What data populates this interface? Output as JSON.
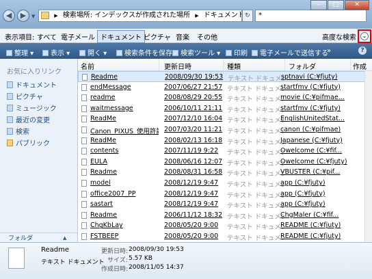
{
  "address": {
    "path_root": "検索場所: インデックスが作成された場所",
    "path_sep": "▶",
    "path_leaf": "ドキュメント",
    "search_value": "*"
  },
  "filter": {
    "label": "表示項目:",
    "items": [
      "すべて",
      "電子メール",
      "ドキュメント",
      "ピクチャ",
      "音楽",
      "その他"
    ],
    "advanced": "高度な検索"
  },
  "toolbar": {
    "items": [
      "整理",
      "表示",
      "開く",
      "検索条件を保存",
      "検索ツール",
      "印刷",
      "電子メールで送信する"
    ],
    "more": "»",
    "help": "?"
  },
  "nav": {
    "title": "お気に入りリンク",
    "items": [
      "ドキュメント",
      "ピクチャ",
      "ミュージック",
      "最近の変更",
      "検索",
      "パブリック"
    ],
    "folder_label": "フォルダ"
  },
  "columns": [
    "名前",
    "更新日時",
    "種類",
    "フォルダ",
    "作成"
  ],
  "rows": [
    {
      "name": "Readme",
      "date": "2008/09/30 19:53",
      "type": "テキスト ドキュメント",
      "folder": "sptnavi (C:¥fjuty)"
    },
    {
      "name": "endMessage",
      "date": "2007/06/27 21:57",
      "type": "テキスト ドキュメント",
      "folder": "startfmv (C:¥fjuty)"
    },
    {
      "name": "readme",
      "date": "2008/08/29 20:55",
      "type": "テキスト ドキュメント",
      "folder": "movie (C:¥pifmae..."
    },
    {
      "name": "waitmessage",
      "date": "2006/10/11 21:11",
      "type": "テキスト ドキュメント",
      "folder": "startfmv (C:¥fjuty)"
    },
    {
      "name": "ReadMe",
      "date": "2007/12/10 16:04",
      "type": "テキスト ドキュメント",
      "folder": "EnglishUnitedStat..."
    },
    {
      "name": "Canon_PIXUS_使用許諾",
      "date": "2007/03/20 11:21",
      "type": "テキスト ドキュメント",
      "folder": "canon (C:¥pifmae)"
    },
    {
      "name": "ReadMe",
      "date": "2008/02/13 16:18",
      "type": "テキスト ドキュメント",
      "folder": "Japanese (C:¥fjuty)"
    },
    {
      "name": "contents",
      "date": "2007/11/19 9:22",
      "type": "テキスト ドキュメント",
      "folder": "Owelcome (C:¥fif..."
    },
    {
      "name": "EULA",
      "date": "2008/06/16 12:07",
      "type": "テキスト ドキュメント",
      "folder": "Owelcome (C:¥fjuty)"
    },
    {
      "name": "Readme",
      "date": "2008/08/31 16:58",
      "type": "テキスト ドキュメント",
      "folder": "VBUSTER (C:¥pif..."
    },
    {
      "name": "model",
      "date": "2008/12/19 9:47",
      "type": "テキスト ドキュメント",
      "folder": "app (C:¥fjuty)"
    },
    {
      "name": "office2007_PP",
      "date": "2008/12/19 9:47",
      "type": "テキスト ドキュメント",
      "folder": "app (C:¥fjuty)"
    },
    {
      "name": "sastart",
      "date": "2008/12/19 9:47",
      "type": "テキスト ドキュメント",
      "folder": "app (C:¥fjuty)"
    },
    {
      "name": "Readme",
      "date": "2006/11/12 18:32",
      "type": "テキスト ドキュメント",
      "folder": "ChgMaler (C:¥fif..."
    },
    {
      "name": "ChgKbLay",
      "date": "2008/05/20 9:00",
      "type": "テキスト ドキュメント",
      "folder": "README (C:¥fjuty)"
    },
    {
      "name": "FSTBEEP",
      "date": "2008/05/20 9:00",
      "type": "テキスト ドキュメント",
      "folder": "README (C:¥fjuty)"
    }
  ],
  "details": {
    "name": "Readme",
    "type": "テキスト ドキュメント",
    "modified_label": "更新日時:",
    "modified_value": "2008/09/30 19:53",
    "size_label": "サイズ:",
    "size_value": "5.57 KB",
    "created_label": "作成日時:",
    "created_value": "2008/11/05 14:37"
  }
}
